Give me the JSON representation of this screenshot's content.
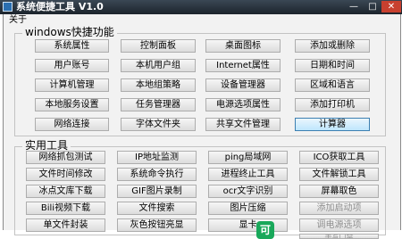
{
  "window": {
    "title": "系统便捷工具 V1.0",
    "controls": {
      "minimize": "—",
      "maximize": "□",
      "close": "✕"
    }
  },
  "menu": {
    "about": "关于"
  },
  "groups": {
    "windows": {
      "title": "windows快捷功能",
      "buttons": [
        "系统属性",
        "控制面板",
        "桌面图标",
        "添加或删除",
        "用户账号",
        "本机用户组",
        "Internet属性",
        "日期和时间",
        "计算机管理",
        "本地组策略",
        "设备管理器",
        "区域和语言",
        "本地服务设置",
        "任务管理器",
        "电源选项属性",
        "添加打印机",
        "网络连接",
        "字体文件夹",
        "共享文件管理",
        "计算器"
      ]
    },
    "tools": {
      "title": "实用工具",
      "buttons": [
        "网络抓包测试",
        "IP地址监测",
        "ping局域网",
        "ICO获取工具",
        "文件时间修改",
        "系统命令执行",
        "进程终止工具",
        "文件解锁工具",
        "冰点文库下载",
        "GIF图片录制",
        "ocr文字识别",
        "屏幕取色",
        "Bili视频下载",
        "文件搜索",
        "图片压缩",
        "添加启动项",
        "单文件封装",
        "灰色按钮亮显",
        "显卡",
        "调电源选项",
        "手写门禁"
      ]
    }
  },
  "overlay": {
    "badge": "可"
  }
}
